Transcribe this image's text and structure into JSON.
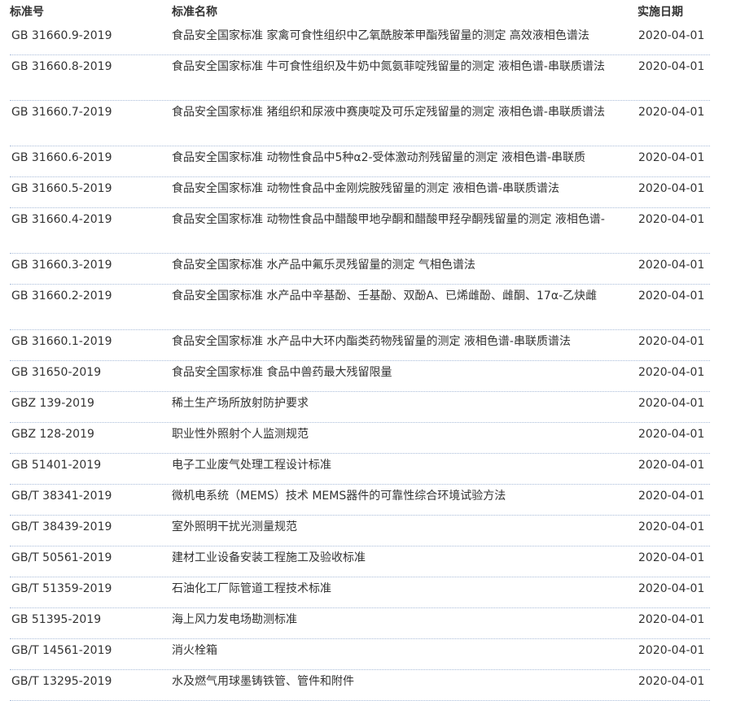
{
  "header": {
    "code": "标准号",
    "name": "标准名称",
    "date": "实施日期"
  },
  "rows": [
    {
      "code": "GB 31660.9-2019",
      "name": "食品安全国家标准 家禽可食性组织中乙氧酰胺苯甲酯残留量的测定 高效液相色谱法",
      "date": "2020-04-01"
    },
    {
      "code": "GB 31660.8-2019",
      "name": "食品安全国家标准 牛可食性组织及牛奶中氮氨菲啶残留量的测定 液相色谱-串联质谱法",
      "date": "2020-04-01"
    },
    {
      "code": "GB 31660.7-2019",
      "name": "食品安全国家标准 猪组织和尿液中赛庚啶及可乐定残留量的测定 液相色谱-串联质谱法",
      "date": "2020-04-01"
    },
    {
      "code": "GB 31660.6-2019",
      "name": "食品安全国家标准 动物性食品中5种α2-受体激动剂残留量的测定 液相色谱-串联质",
      "date": "2020-04-01"
    },
    {
      "code": "GB 31660.5-2019",
      "name": "食品安全国家标准 动物性食品中金刚烷胺残留量的测定 液相色谱-串联质谱法",
      "date": "2020-04-01"
    },
    {
      "code": "GB 31660.4-2019",
      "name": "食品安全国家标准 动物性食品中醋酸甲地孕酮和醋酸甲羟孕酮残留量的测定 液相色谱-",
      "date": "2020-04-01"
    },
    {
      "code": "GB 31660.3-2019",
      "name": "食品安全国家标准 水产品中氟乐灵残留量的测定 气相色谱法",
      "date": "2020-04-01"
    },
    {
      "code": "GB 31660.2-2019",
      "name": "食品安全国家标准 水产品中辛基酚、壬基酚、双酚A、已烯雌酚、雌酮、17α-乙炔雌",
      "date": "2020-04-01"
    },
    {
      "code": "GB 31660.1-2019",
      "name": "食品安全国家标准 水产品中大环内酯类药物残留量的测定 液相色谱-串联质谱法",
      "date": "2020-04-01"
    },
    {
      "code": "GB 31650-2019",
      "name": "食品安全国家标准 食品中兽药最大残留限量",
      "date": "2020-04-01"
    },
    {
      "code": "GBZ 139-2019",
      "name": "稀土生产场所放射防护要求",
      "date": "2020-04-01"
    },
    {
      "code": "GBZ 128-2019",
      "name": "职业性外照射个人监测规范",
      "date": "2020-04-01"
    },
    {
      "code": "GB 51401-2019",
      "name": "电子工业废气处理工程设计标准",
      "date": "2020-04-01"
    },
    {
      "code": "GB/T 38341-2019",
      "name": "微机电系统（MEMS）技术 MEMS器件的可靠性综合环境试验方法",
      "date": "2020-04-01"
    },
    {
      "code": "GB/T 38439-2019",
      "name": "室外照明干扰光测量规范",
      "date": "2020-04-01"
    },
    {
      "code": "GB/T 50561-2019",
      "name": "建材工业设备安装工程施工及验收标准",
      "date": "2020-04-01"
    },
    {
      "code": "GB/T 51359-2019",
      "name": "石油化工厂际管道工程技术标准",
      "date": "2020-04-01"
    },
    {
      "code": "GB 51395-2019",
      "name": "海上风力发电场勘测标准",
      "date": "2020-04-01"
    },
    {
      "code": "GB/T 14561-2019",
      "name": "消火栓箱",
      "date": "2020-04-01"
    },
    {
      "code": "GB/T 13295-2019",
      "name": "水及燃气用球墨铸铁管、管件和附件",
      "date": "2020-04-01"
    }
  ]
}
